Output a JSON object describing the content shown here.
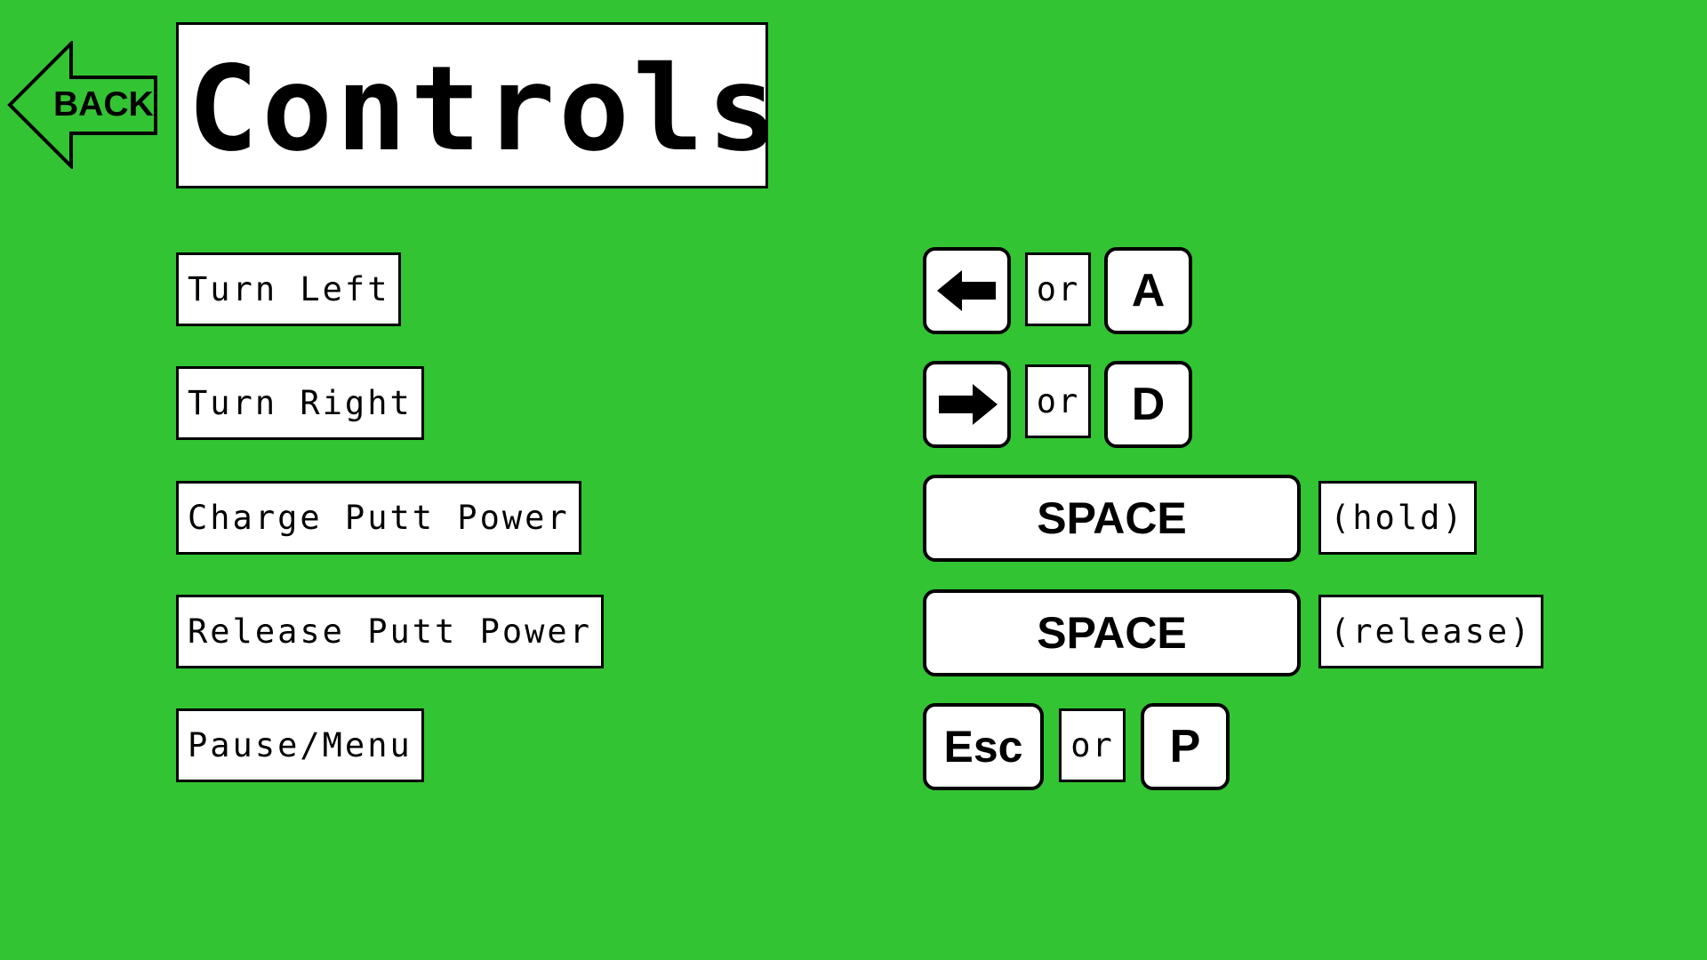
{
  "page": {
    "background_color": "#33c433",
    "title": "Controls"
  },
  "back_button": {
    "label": "BACK",
    "icon": "left-arrow-outline-icon"
  },
  "controls": [
    {
      "action": "Turn Left",
      "keys": [
        {
          "label": "",
          "icon": "arrow-left-icon"
        },
        {
          "label": "A"
        }
      ],
      "separator": "or"
    },
    {
      "action": "Turn Right",
      "keys": [
        {
          "label": "",
          "icon": "arrow-right-icon"
        },
        {
          "label": "D"
        }
      ],
      "separator": "or"
    },
    {
      "action": "Charge Putt Power",
      "keys": [
        {
          "label": "SPACE"
        }
      ],
      "note": "(hold)"
    },
    {
      "action": "Release Putt Power",
      "keys": [
        {
          "label": "SPACE"
        }
      ],
      "note": "(release)"
    },
    {
      "action": "Pause/Menu",
      "keys": [
        {
          "label": "Esc"
        },
        {
          "label": "P"
        }
      ],
      "separator": "or"
    }
  ]
}
